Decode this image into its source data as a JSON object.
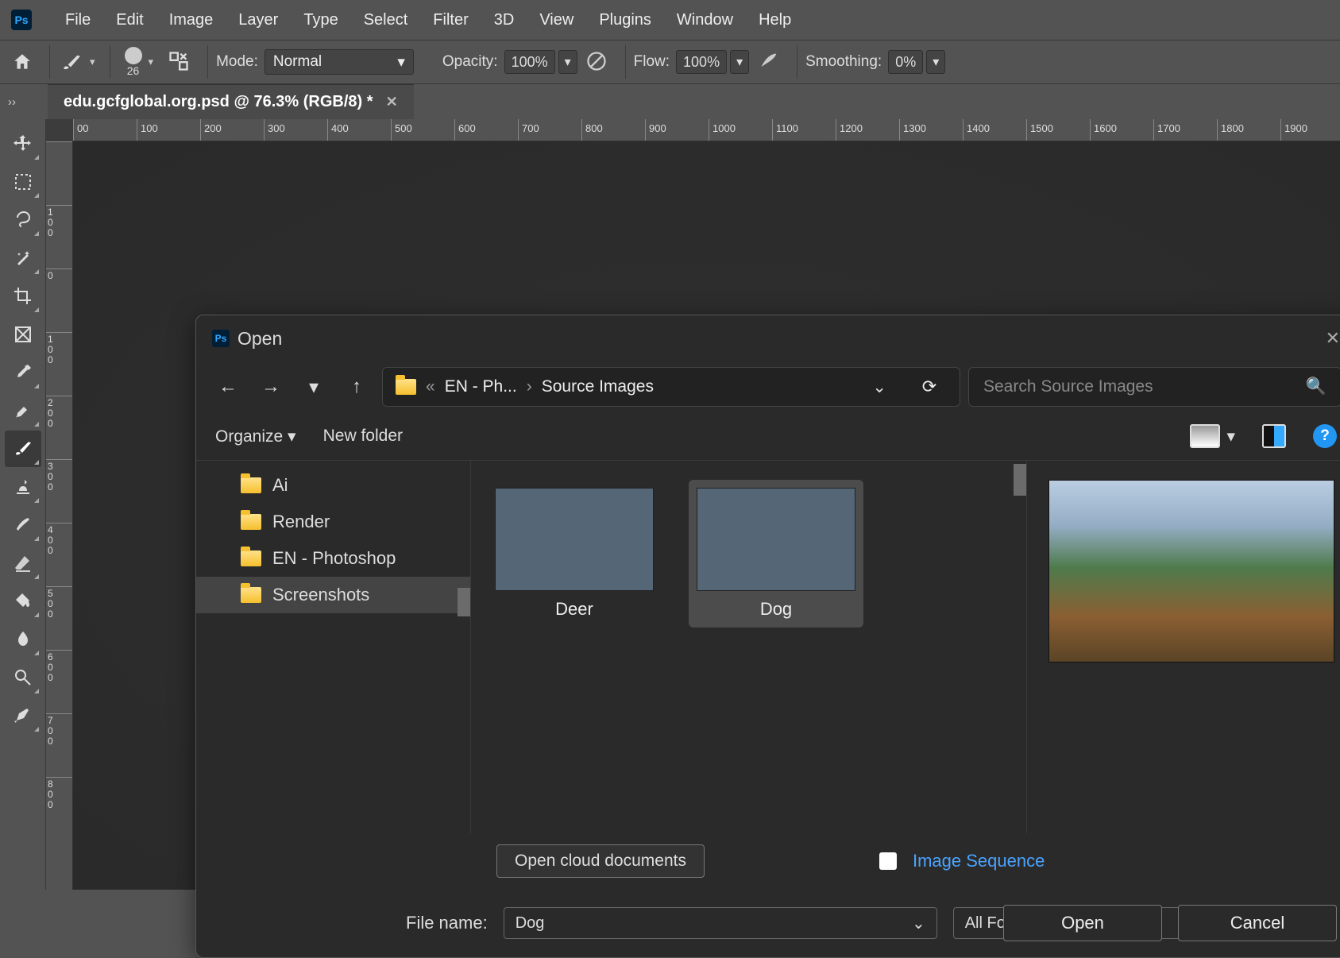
{
  "menu": [
    "File",
    "Edit",
    "Image",
    "Layer",
    "Type",
    "Select",
    "Filter",
    "3D",
    "View",
    "Plugins",
    "Window",
    "Help"
  ],
  "options": {
    "brush_size": "26",
    "mode_label": "Mode:",
    "mode_value": "Normal",
    "opacity_label": "Opacity:",
    "opacity_value": "100%",
    "flow_label": "Flow:",
    "flow_value": "100%",
    "smoothing_label": "Smoothing:",
    "smoothing_value": "0%"
  },
  "tab": {
    "title": "edu.gcfglobal.org.psd @ 76.3% (RGB/8) *"
  },
  "ruler_h": [
    "00",
    "100",
    "200",
    "300",
    "400",
    "500",
    "600",
    "700",
    "800",
    "900",
    "1000",
    "1100",
    "1200",
    "1300",
    "1400",
    "1500",
    "1600",
    "1700",
    "1800",
    "1900"
  ],
  "ruler_v": [
    "",
    "100",
    "0",
    "100",
    "200",
    "300",
    "400",
    "500",
    "600",
    "700",
    "800"
  ],
  "dialog": {
    "title": "Open",
    "breadcrumb": {
      "ellipsis": "«",
      "parent": "EN - Ph...",
      "sep": "›",
      "current": "Source Images"
    },
    "search_placeholder": "Search Source Images",
    "organize": "Organize",
    "new_folder": "New folder",
    "help": "?",
    "tree": [
      "Ai",
      "Render",
      "EN - Photoshop",
      "Screenshots"
    ],
    "tree_selected": 3,
    "thumbs": [
      {
        "name": "Deer"
      },
      {
        "name": "Dog"
      }
    ],
    "thumb_selected": 1,
    "cloud_btn": "Open cloud documents",
    "image_sequence": "Image Sequence",
    "filename_label": "File name:",
    "filename_value": "Dog",
    "format_value": "All Formats",
    "open_btn": "Open",
    "cancel_btn": "Cancel"
  }
}
